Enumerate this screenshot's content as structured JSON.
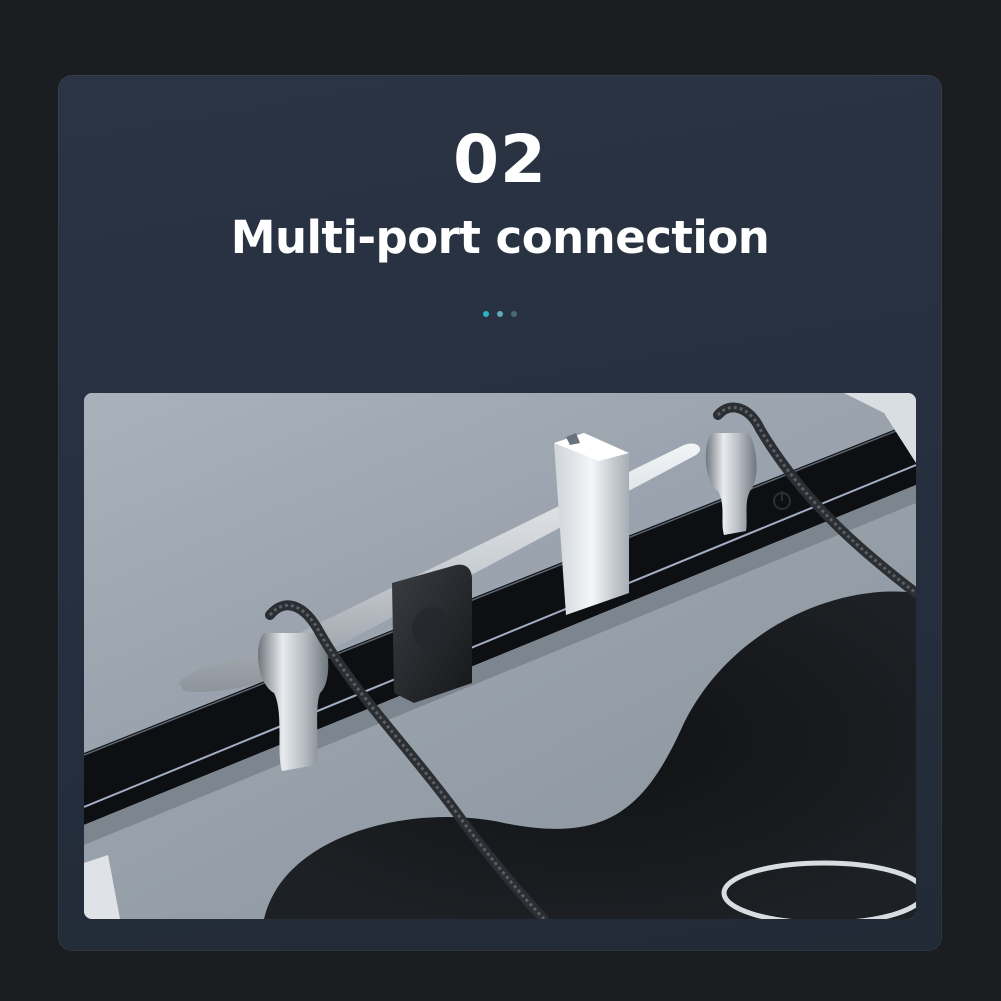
{
  "hero": {
    "step_number": "02",
    "headline": "Multi-port connection"
  },
  "pagination": {
    "dot_colors": [
      "#2ab6c4",
      "#62aab8",
      "#4a6a78"
    ]
  },
  "photo": {
    "subject": "center console USB hub with cables, flash drive and adapter",
    "icon": "power-icon"
  },
  "colors": {
    "background": "#1c1d20",
    "card": "#263040",
    "accent": "#2ab6c4"
  }
}
